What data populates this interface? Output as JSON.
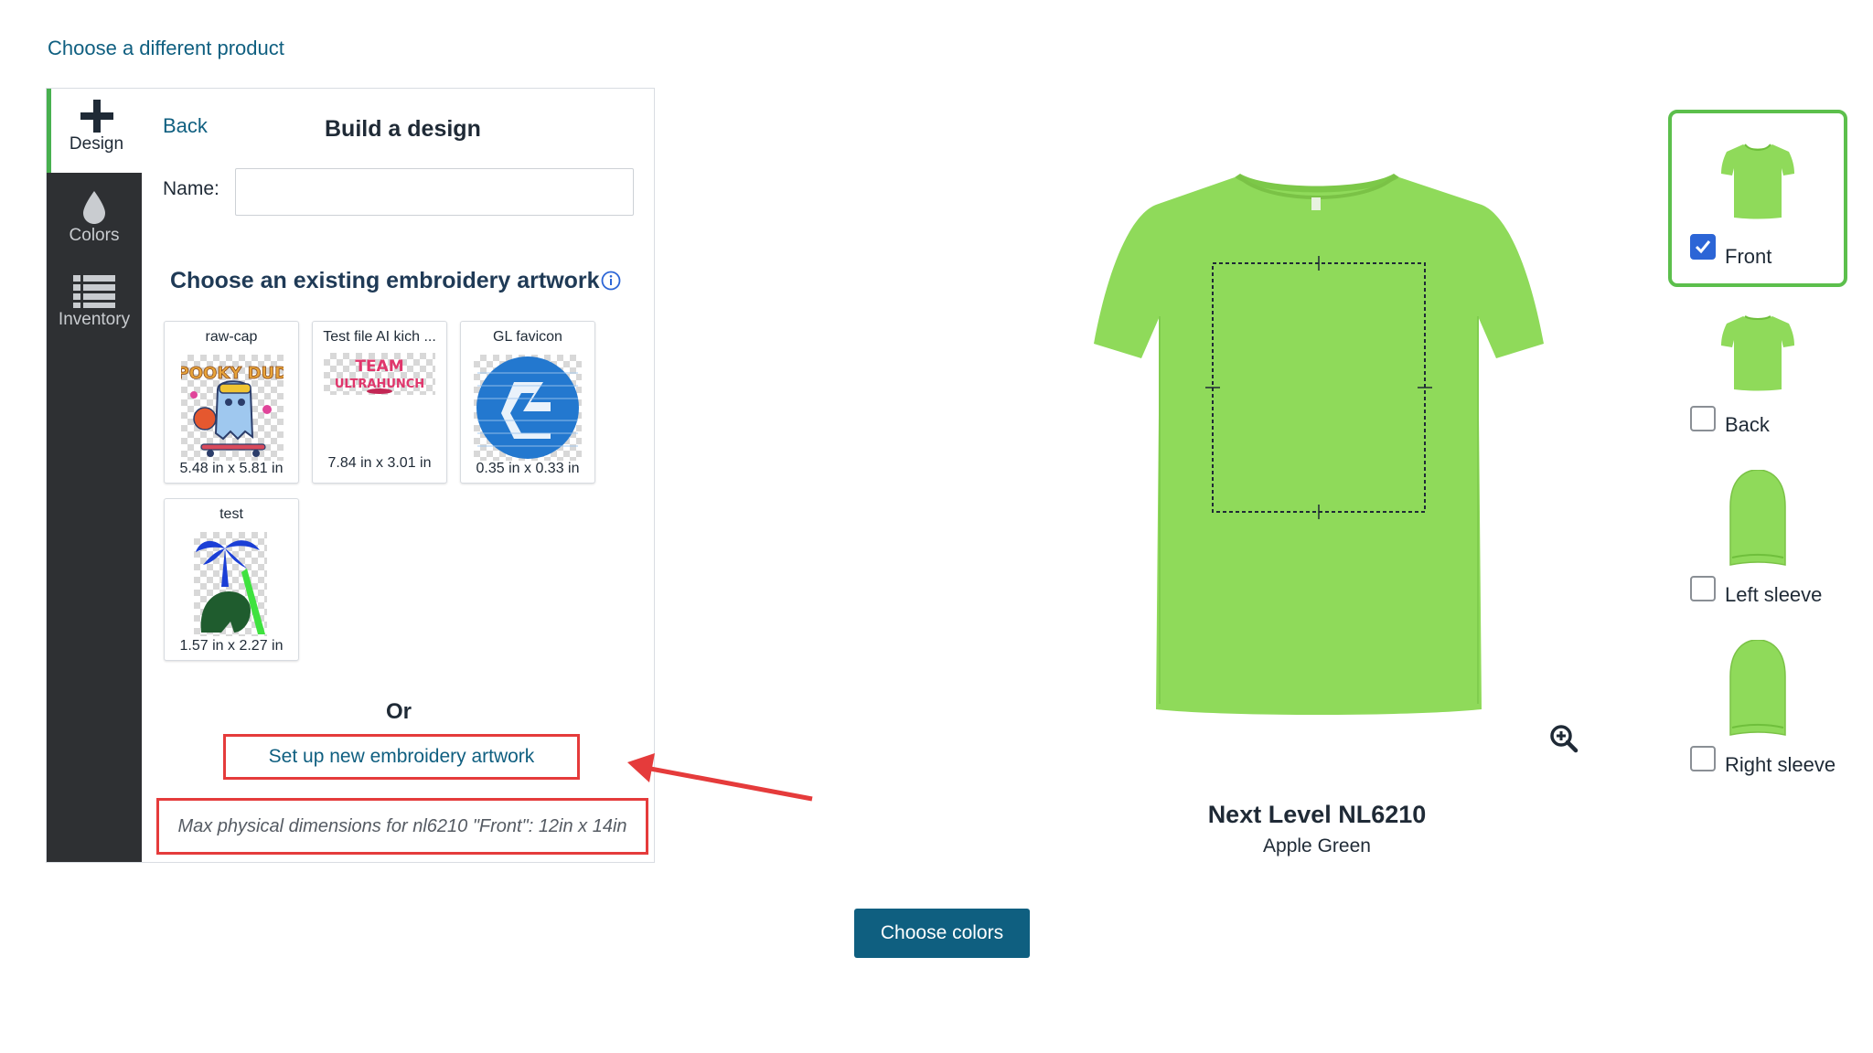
{
  "nav": {
    "choose_product_link": "Choose a different product"
  },
  "sidebar": {
    "items": [
      {
        "label": "Design",
        "icon": "plus-icon",
        "active": true
      },
      {
        "label": "Colors",
        "icon": "drop-icon",
        "active": false
      },
      {
        "label": "Inventory",
        "icon": "list-icon",
        "active": false
      }
    ]
  },
  "panel": {
    "back_label": "Back",
    "title": "Build a design",
    "name_label": "Name:",
    "name_value": "",
    "section_title": "Choose an existing embroidery artwork",
    "artworks": [
      {
        "title": "raw-cap",
        "dimensions": "5.48 in x 5.81 in"
      },
      {
        "title": "Test file AI kich ...",
        "dimensions": "7.84 in x 3.01 in"
      },
      {
        "title": "GL favicon",
        "dimensions": "0.35 in x 0.33 in"
      },
      {
        "title": "test",
        "dimensions": "1.57 in x 2.27 in"
      }
    ],
    "or_label": "Or",
    "new_artwork_button": "Set up new embroidery artwork",
    "max_dimensions_note": "Max physical dimensions for nl6210 \"Front\": 12in x 14in"
  },
  "product": {
    "name": "Next Level NL6210",
    "color_name": "Apple Green",
    "shirt_color": "#8fda5a"
  },
  "actions": {
    "choose_colors_button": "Choose colors"
  },
  "views": [
    {
      "label": "Front",
      "checked": true
    },
    {
      "label": "Back",
      "checked": false
    },
    {
      "label": "Left sleeve",
      "checked": false
    },
    {
      "label": "Right sleeve",
      "checked": false
    }
  ],
  "colors": {
    "accent": "#0f5f80",
    "highlight": "#e53b3b",
    "selected_border": "#5cbf4c",
    "rail_bg": "#2e3033"
  }
}
